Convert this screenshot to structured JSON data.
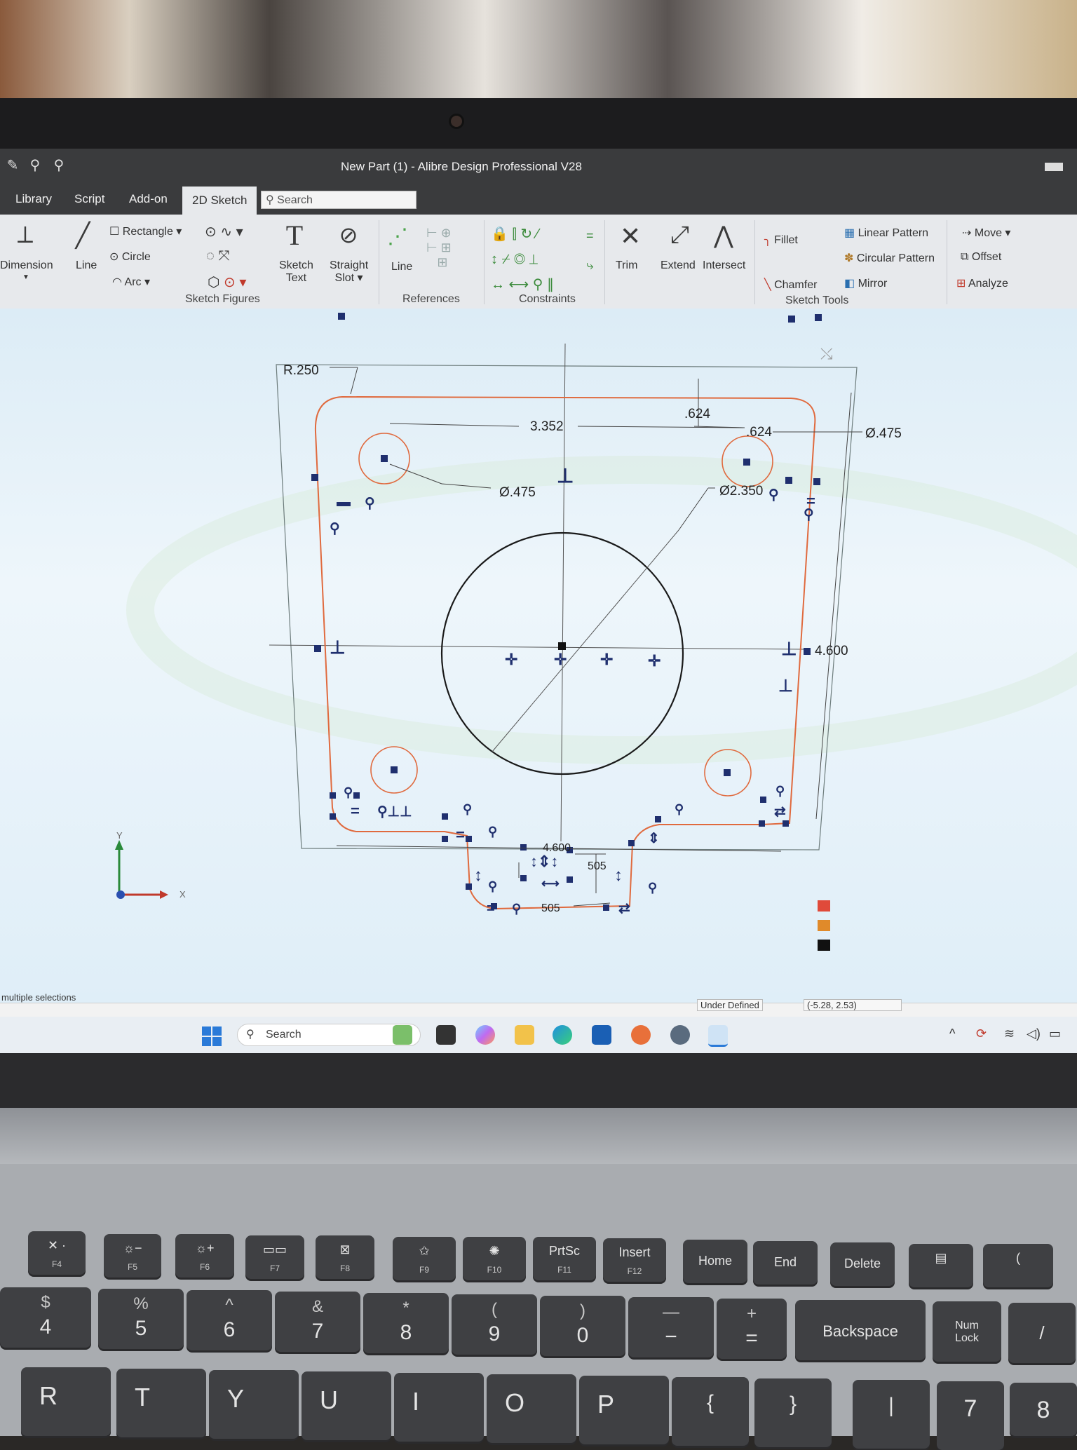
{
  "app": {
    "title": "New Part (1) - Alibre Design Professional V28",
    "tabs": [
      {
        "label": "Library"
      },
      {
        "label": "Script"
      },
      {
        "label": "Add-on"
      },
      {
        "label": "2D Sketch"
      }
    ],
    "search_placeholder": "Search"
  },
  "ribbon": {
    "dimension": "Dimension",
    "line": "Line",
    "rectangle": "Rectangle",
    "circle": "Circle",
    "arc": "Arc",
    "sketch_text": [
      "Sketch",
      "Text"
    ],
    "straight_slot": [
      "Straight",
      "Slot"
    ],
    "ref_line": "Line",
    "trim": "Trim",
    "extend": "Extend",
    "intersect": "Intersect",
    "fillet": "Fillet",
    "chamfer": "Chamfer",
    "linear_pattern": "Linear Pattern",
    "circular_pattern": "Circular Pattern",
    "mirror": "Mirror",
    "move": "Move",
    "offset": "Offset",
    "analyze": "Analyze",
    "groups": {
      "sketch_figures": "Sketch Figures",
      "references": "References",
      "constraints": "Constraints",
      "sketch_tools": "Sketch Tools"
    }
  },
  "sketch": {
    "dim_r250": "R.250",
    "dim_3352": "3.352",
    "dim_dia475_left": "Ø.475",
    "dim_624_a": ".624",
    "dim_624_b": ".624",
    "dim_dia475_right": "Ø.475",
    "dim_dia2350": "Ø2.350",
    "dim_4600_right": "4.600",
    "dim_4600_bottom": "4.600",
    "dim_505_a": "505",
    "dim_505_b": "505",
    "axis_x": "X",
    "axis_y": "Y",
    "colors": {
      "profile": "#e06a3e",
      "constraint": "#1f2f6e",
      "geometry": "#1a1a1a",
      "axis_green": "#2a8a3a",
      "axis_red": "#c0392b",
      "axis_blue": "#2a4fb0"
    }
  },
  "status": {
    "left": "multiple selections",
    "state": "Under Defined",
    "coords": "(-5.28, 2.53)"
  },
  "taskbar": {
    "search_placeholder": "Search"
  },
  "keyboard": {
    "fn_row": [
      {
        "top": "✕ ·",
        "sub": "F4"
      },
      {
        "top": "☼−",
        "sub": "F5"
      },
      {
        "top": "☼+",
        "sub": "F6"
      },
      {
        "top": "▭▭",
        "sub": "F7"
      },
      {
        "top": "⊠",
        "sub": "F8"
      },
      {
        "top": "✩",
        "sub": "F9"
      },
      {
        "top": "✺",
        "sub": "F10"
      },
      {
        "top": "PrtSc",
        "sub": "F11"
      },
      {
        "top": "Insert",
        "sub": "F12"
      },
      {
        "top": "Home",
        "sub": ""
      },
      {
        "top": "End",
        "sub": ""
      },
      {
        "top": "Delete",
        "sub": ""
      }
    ],
    "num_row": [
      {
        "shift": "$",
        "main": "4"
      },
      {
        "shift": "%",
        "main": "5"
      },
      {
        "shift": "^",
        "main": "6"
      },
      {
        "shift": "&",
        "main": "7"
      },
      {
        "shift": "*",
        "main": "8"
      },
      {
        "shift": "(",
        "main": "9"
      },
      {
        "shift": ")",
        "main": "0"
      },
      {
        "shift": "—",
        "main": "−"
      },
      {
        "shift": "+",
        "main": "="
      }
    ],
    "backspace": "Backspace",
    "numlock": [
      "Num",
      "Lock"
    ],
    "letter_row": [
      "R",
      "T",
      "Y",
      "U",
      "I",
      "O",
      "P",
      "{",
      "}",
      "|",
      "7",
      "8"
    ]
  }
}
